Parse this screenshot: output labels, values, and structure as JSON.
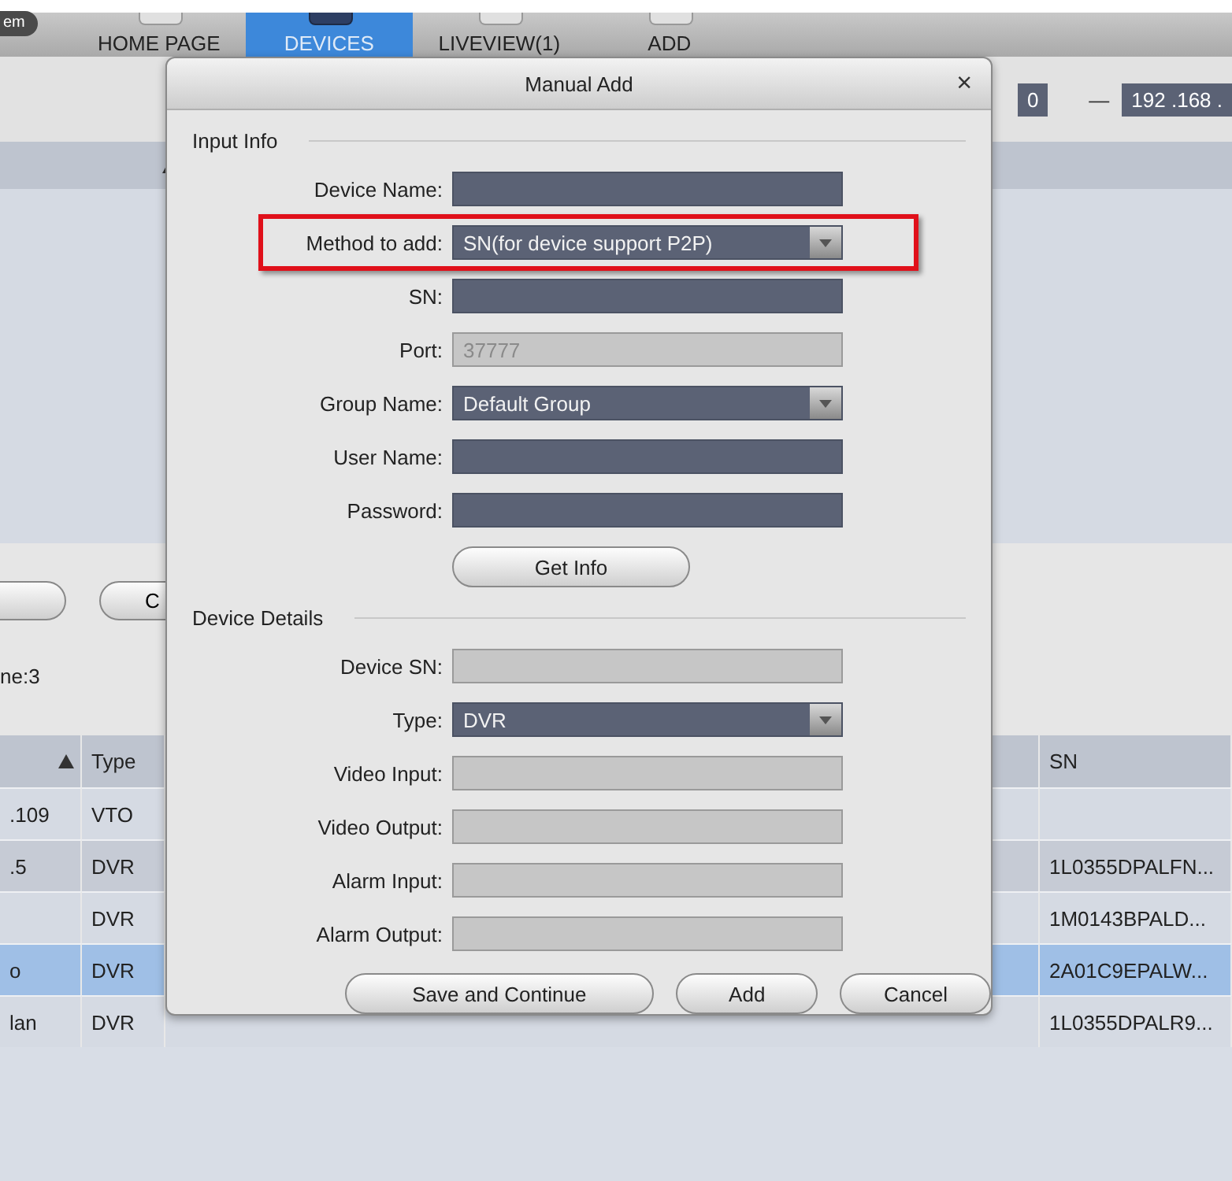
{
  "nav": {
    "user_pill": "em",
    "tabs": [
      {
        "label": "HOME PAGE",
        "selected": false
      },
      {
        "label": "DEVICES",
        "selected": true
      },
      {
        "label": "LIVEVIEW(1)",
        "selected": false
      },
      {
        "label": "ADD",
        "selected": false
      }
    ]
  },
  "ip_range": {
    "start": "0",
    "separator": "—",
    "end": "192 .168 ."
  },
  "action_button": "C",
  "count_label": "ne:3",
  "table": {
    "columns": [
      {
        "sorted": true
      },
      {
        "label": "Type",
        "sorted": false
      },
      {
        "label": "SN",
        "sorted": false
      }
    ],
    "rows": [
      {
        "cells": [
          ".109",
          "VTO"
        ],
        "selected": false
      },
      {
        "cells": [
          ".5",
          "DVR"
        ],
        "sn": "1L0355DPALFN...",
        "selected": false
      },
      {
        "cells": [
          "",
          "DVR"
        ],
        "sn": "1M0143BPALD...",
        "selected": false
      },
      {
        "cells": [
          "o",
          "DVR"
        ],
        "sn": "2A01C9EPALW...",
        "selected": true
      },
      {
        "cells": [
          "lan",
          "DVR"
        ],
        "sn": "1L0355DPALR9...",
        "selected": false
      }
    ]
  },
  "dialog": {
    "title": "Manual Add",
    "close": "×",
    "sections": [
      {
        "heading": "Input Info",
        "fields": [
          {
            "label": "Device Name:",
            "kind": "text",
            "disabled": false
          },
          {
            "label": "Method to add:",
            "kind": "select",
            "value": "SN(for device support P2P)",
            "disabled": false,
            "highlighted": true
          },
          {
            "label": "SN:",
            "kind": "text",
            "disabled": false
          },
          {
            "label": "Port:",
            "kind": "text",
            "value": "37777",
            "disabled": true
          },
          {
            "label": "Group Name:",
            "kind": "select",
            "value": "Default Group",
            "disabled": false
          },
          {
            "label": "User Name:",
            "kind": "text",
            "disabled": false
          },
          {
            "label": "Password:",
            "kind": "text",
            "disabled": false
          }
        ],
        "action": "Get Info"
      },
      {
        "heading": "Device Details",
        "fields": [
          {
            "label": "Device SN:",
            "kind": "text",
            "disabled": true
          },
          {
            "label": "Type:",
            "kind": "select",
            "value": "DVR",
            "disabled": false
          },
          {
            "label": "Video Input:",
            "kind": "text",
            "disabled": true
          },
          {
            "label": "Video Output:",
            "kind": "text",
            "disabled": true
          },
          {
            "label": "Alarm Input:",
            "kind": "text",
            "disabled": true
          },
          {
            "label": "Alarm Output:",
            "kind": "text",
            "disabled": true
          }
        ]
      }
    ],
    "buttons": [
      "Save and Continue",
      "Add",
      "Cancel"
    ]
  }
}
